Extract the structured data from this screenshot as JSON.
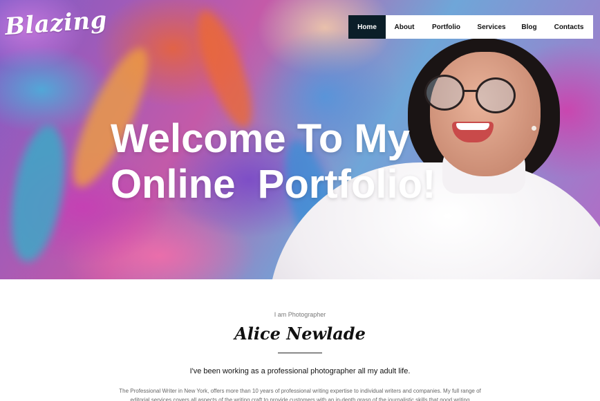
{
  "brand": {
    "logo_text": "Blazing"
  },
  "nav": {
    "items": [
      {
        "label": "Home",
        "active": true
      },
      {
        "label": "About",
        "active": false
      },
      {
        "label": "Portfolio",
        "active": false
      },
      {
        "label": "Services",
        "active": false
      },
      {
        "label": "Blog",
        "active": false
      },
      {
        "label": "Contacts",
        "active": false
      }
    ]
  },
  "hero": {
    "headline_line1": "Welcome To My",
    "headline_line2": "Online  Portfolio!"
  },
  "intro": {
    "eyebrow": "I am Photographer",
    "name": "Alice Newlade",
    "lead": "I've been working as a professional photographer all my adult life.",
    "body": "The Professional Writer in New York, offers more than 10 years of professional writing expertise to individual writers and companies. My full range of editorial services covers all aspects of the writing craft to provide customers with an in-depth grasp of the journalistic skills that good writing"
  },
  "colors": {
    "nav_active_bg": "#0b1e28",
    "nav_bg": "#ffffff",
    "text_dark": "#111111",
    "text_muted": "#666666"
  }
}
